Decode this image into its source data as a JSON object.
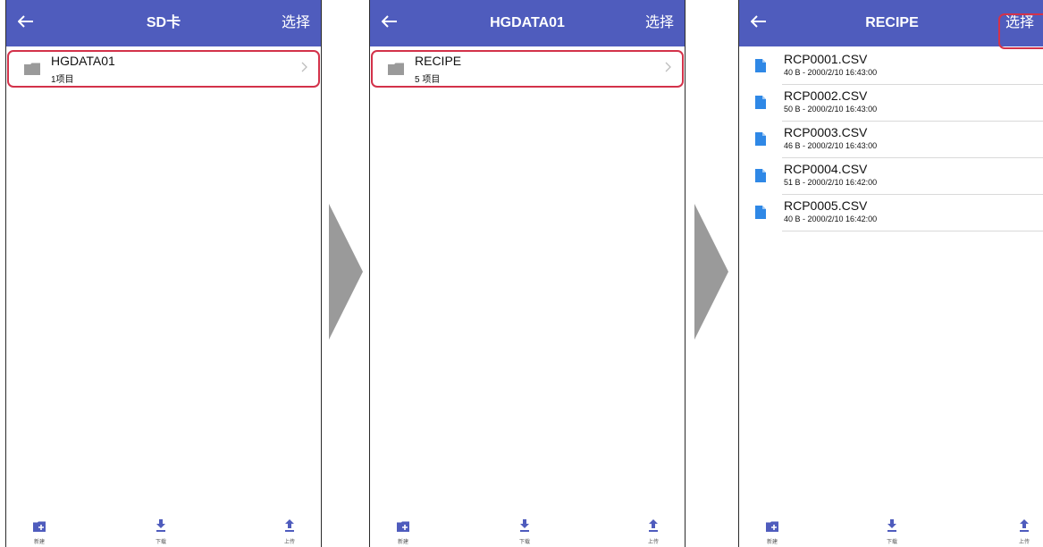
{
  "colors": {
    "appbar": "#4f5cbd",
    "highlight": "#d3324a",
    "file_icon": "#2f88e6",
    "folder_icon": "#9a9a9a",
    "arrow": "#9a9a9a"
  },
  "screens": [
    {
      "title": "SD卡",
      "select_label": "选择",
      "folder": {
        "name": "HGDATA01",
        "count": "1项目"
      },
      "toolbar": {
        "new": "新建",
        "download": "下载",
        "upload": "上传"
      }
    },
    {
      "title": "HGDATA01",
      "select_label": "选择",
      "folder": {
        "name": "RECIPE",
        "count": "5 项目"
      },
      "toolbar": {
        "new": "新建",
        "download": "下载",
        "upload": "上传"
      }
    },
    {
      "title": "RECIPE",
      "select_label": "选择",
      "files": [
        {
          "name": "RCP0001.CSV",
          "meta": "40 B - 2000/2/10 16:43:00"
        },
        {
          "name": "RCP0002.CSV",
          "meta": "50 B - 2000/2/10 16:43:00"
        },
        {
          "name": "RCP0003.CSV",
          "meta": "46 B - 2000/2/10 16:43:00"
        },
        {
          "name": "RCP0004.CSV",
          "meta": "51 B - 2000/2/10 16:42:00"
        },
        {
          "name": "RCP0005.CSV",
          "meta": "40 B - 2000/2/10 16:42:00"
        }
      ],
      "toolbar": {
        "new": "新建",
        "download": "下载",
        "upload": "上传"
      }
    }
  ]
}
